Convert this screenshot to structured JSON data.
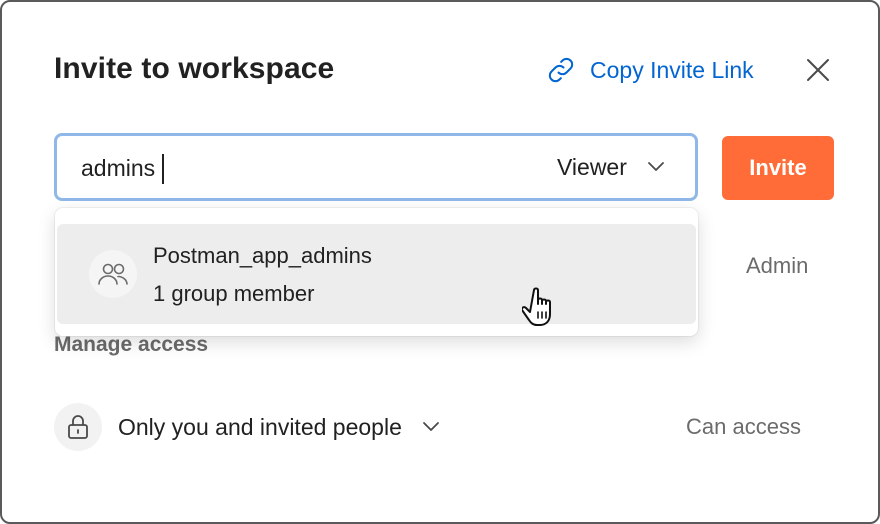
{
  "modal": {
    "title": "Invite to workspace",
    "copy_link_label": "Copy Invite Link",
    "close_icon": "close-icon"
  },
  "invite_form": {
    "search_value": "admins",
    "role_value": "Viewer",
    "invite_label": "Invite"
  },
  "dropdown": {
    "items": [
      {
        "name": "Postman_app_admins",
        "meta": "1 group member",
        "icon": "group-icon"
      }
    ]
  },
  "member_row": {
    "role": "Admin"
  },
  "access": {
    "section_label": "Manage access",
    "scope_value": "Only you and invited people",
    "permission_label": "Can access",
    "icon": "lock-icon"
  },
  "colors": {
    "accent_orange": "#ff6c37",
    "link_blue": "#0265d2",
    "focus_border": "#8fb8e8",
    "muted_text": "#6b6b6b"
  }
}
